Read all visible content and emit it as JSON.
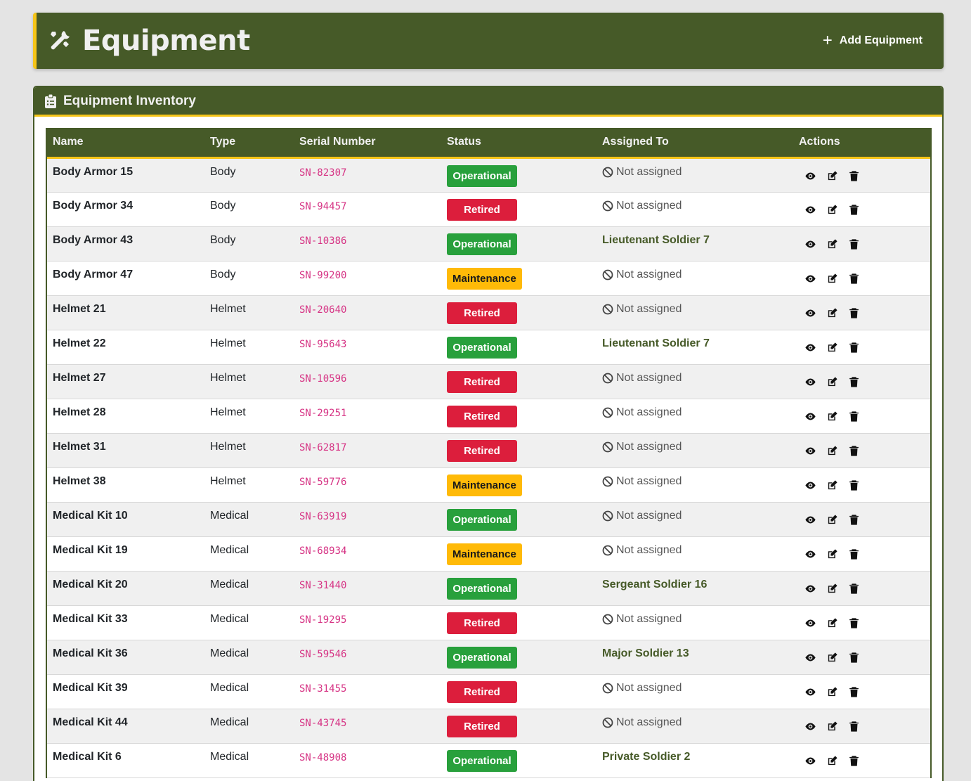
{
  "header": {
    "title": "Equipment",
    "add_button": "Add Equipment"
  },
  "card": {
    "title": "Equipment Inventory"
  },
  "table": {
    "columns": [
      "Name",
      "Type",
      "Serial Number",
      "Status",
      "Assigned To",
      "Actions"
    ],
    "rows": [
      {
        "name": "Body Armor 15",
        "type": "Body",
        "serial": "SN-82307",
        "status": "Operational",
        "assigned": "Not assigned"
      },
      {
        "name": "Body Armor 34",
        "type": "Body",
        "serial": "SN-94457",
        "status": "Retired",
        "assigned": "Not assigned"
      },
      {
        "name": "Body Armor 43",
        "type": "Body",
        "serial": "SN-10386",
        "status": "Operational",
        "assigned": "Lieutenant Soldier 7"
      },
      {
        "name": "Body Armor 47",
        "type": "Body",
        "serial": "SN-99200",
        "status": "Maintenance",
        "assigned": "Not assigned"
      },
      {
        "name": "Helmet 21",
        "type": "Helmet",
        "serial": "SN-20640",
        "status": "Retired",
        "assigned": "Not assigned"
      },
      {
        "name": "Helmet 22",
        "type": "Helmet",
        "serial": "SN-95643",
        "status": "Operational",
        "assigned": "Lieutenant Soldier 7"
      },
      {
        "name": "Helmet 27",
        "type": "Helmet",
        "serial": "SN-10596",
        "status": "Retired",
        "assigned": "Not assigned"
      },
      {
        "name": "Helmet 28",
        "type": "Helmet",
        "serial": "SN-29251",
        "status": "Retired",
        "assigned": "Not assigned"
      },
      {
        "name": "Helmet 31",
        "type": "Helmet",
        "serial": "SN-62817",
        "status": "Retired",
        "assigned": "Not assigned"
      },
      {
        "name": "Helmet 38",
        "type": "Helmet",
        "serial": "SN-59776",
        "status": "Maintenance",
        "assigned": "Not assigned"
      },
      {
        "name": "Medical Kit 10",
        "type": "Medical",
        "serial": "SN-63919",
        "status": "Operational",
        "assigned": "Not assigned"
      },
      {
        "name": "Medical Kit 19",
        "type": "Medical",
        "serial": "SN-68934",
        "status": "Maintenance",
        "assigned": "Not assigned"
      },
      {
        "name": "Medical Kit 20",
        "type": "Medical",
        "serial": "SN-31440",
        "status": "Operational",
        "assigned": "Sergeant Soldier 16"
      },
      {
        "name": "Medical Kit 33",
        "type": "Medical",
        "serial": "SN-19295",
        "status": "Retired",
        "assigned": "Not assigned"
      },
      {
        "name": "Medical Kit 36",
        "type": "Medical",
        "serial": "SN-59546",
        "status": "Operational",
        "assigned": "Major Soldier 13"
      },
      {
        "name": "Medical Kit 39",
        "type": "Medical",
        "serial": "SN-31455",
        "status": "Retired",
        "assigned": "Not assigned"
      },
      {
        "name": "Medical Kit 44",
        "type": "Medical",
        "serial": "SN-43745",
        "status": "Retired",
        "assigned": "Not assigned"
      },
      {
        "name": "Medical Kit 6",
        "type": "Medical",
        "serial": "SN-48908",
        "status": "Operational",
        "assigned": "Private Soldier 2"
      }
    ]
  },
  "colors": {
    "primary": "#465a28",
    "accent": "#f5c518",
    "operational": "#28a03c",
    "retired": "#dc1e3c",
    "maintenance": "#ffba08"
  },
  "icons": {
    "header": "tools-icon",
    "card": "clipboard-list-icon",
    "unassigned": "ban-icon",
    "actions": [
      "eye-icon",
      "edit-icon",
      "trash-icon"
    ]
  }
}
